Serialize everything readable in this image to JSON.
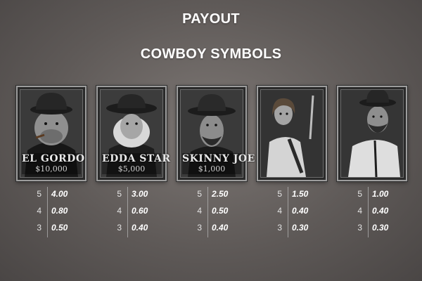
{
  "header": {
    "title": "PAYOUT",
    "subtitle": "COWBOY SYMBOLS"
  },
  "symbols": [
    {
      "id": "el-gordo",
      "name": "EL GORDO",
      "bounty": "$10,000",
      "payouts": [
        {
          "count": "5",
          "value": "4.00"
        },
        {
          "count": "4",
          "value": "0.80"
        },
        {
          "count": "3",
          "value": "0.50"
        }
      ]
    },
    {
      "id": "edda-star",
      "name": "EDDA STAR",
      "bounty": "$5,000",
      "payouts": [
        {
          "count": "5",
          "value": "3.00"
        },
        {
          "count": "4",
          "value": "0.60"
        },
        {
          "count": "3",
          "value": "0.40"
        }
      ]
    },
    {
      "id": "skinny-joe",
      "name": "SKINNY JOE",
      "bounty": "$1,000",
      "payouts": [
        {
          "count": "5",
          "value": "2.50"
        },
        {
          "count": "4",
          "value": "0.50"
        },
        {
          "count": "3",
          "value": "0.40"
        }
      ]
    },
    {
      "id": "gunslinger-woman",
      "payouts": [
        {
          "count": "5",
          "value": "1.50"
        },
        {
          "count": "4",
          "value": "0.40"
        },
        {
          "count": "3",
          "value": "0.30"
        }
      ]
    },
    {
      "id": "bearded-cowboy",
      "payouts": [
        {
          "count": "5",
          "value": "1.00"
        },
        {
          "count": "4",
          "value": "0.40"
        },
        {
          "count": "3",
          "value": "0.30"
        }
      ]
    }
  ],
  "colors": {
    "text": "#ffffff",
    "card_border": "#9d9d9d",
    "card_bg": "#2a2a2a",
    "background": "#5f5a58"
  }
}
